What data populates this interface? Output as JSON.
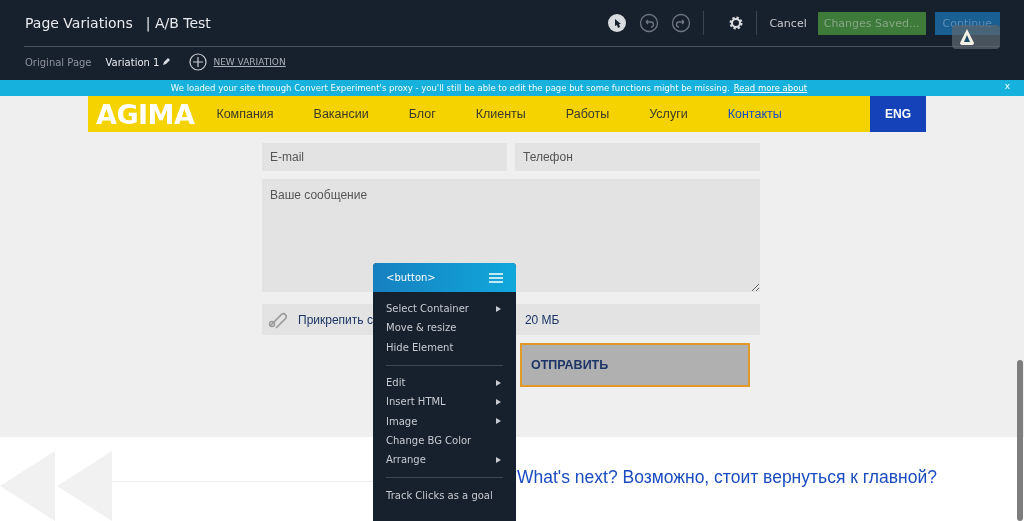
{
  "header": {
    "title": "Page Variations",
    "subtitle": "| A/B Test",
    "cancel": "Cancel",
    "save": "Changes Saved...",
    "continue": "Continue"
  },
  "variations": [
    {
      "label": "Original Page",
      "selected": false
    },
    {
      "label": "Variation 1",
      "selected": true
    }
  ],
  "new_variation": "NEW VARIATION",
  "banner": {
    "text": "We loaded your site through Convert Experiment's proxy - you'll still be able to edit the page but some functions might be missing.",
    "link": "Read more about",
    "close": "x"
  },
  "site": {
    "logo": "AGIMA",
    "nav": [
      {
        "label": "Компания",
        "selected": false
      },
      {
        "label": "Вакансии",
        "selected": false
      },
      {
        "label": "Блог",
        "selected": false
      },
      {
        "label": "Клиенты",
        "selected": false
      },
      {
        "label": "Работы",
        "selected": false
      },
      {
        "label": "Услуги",
        "selected": false
      },
      {
        "label": "Контакты",
        "selected": true
      }
    ],
    "lang": "ENG"
  },
  "form": {
    "email": {
      "placeholder": "E-mail"
    },
    "phone": {
      "placeholder": "Телефон"
    },
    "message": {
      "placeholder": "Ваше сообщение"
    },
    "attach": "Прикрепить с",
    "attach_size": "20 МБ",
    "submit": "ОТПРАВИТЬ"
  },
  "footer_text": "What's next? Возможно, стоит вернуться к главной?",
  "menu": {
    "title": "<button>",
    "groups": [
      [
        {
          "label": "Select Container",
          "submenu": true
        },
        {
          "label": "Move & resize",
          "submenu": false
        },
        {
          "label": "Hide Element",
          "submenu": false
        }
      ],
      [
        {
          "label": "Edit",
          "submenu": true
        },
        {
          "label": "Insert HTML",
          "submenu": true
        },
        {
          "label": "Image",
          "submenu": true
        },
        {
          "label": "Change BG Color",
          "submenu": false
        },
        {
          "label": "Arrange",
          "submenu": true
        }
      ],
      [
        {
          "label": "Track Clicks as a goal",
          "submenu": false
        }
      ]
    ]
  }
}
